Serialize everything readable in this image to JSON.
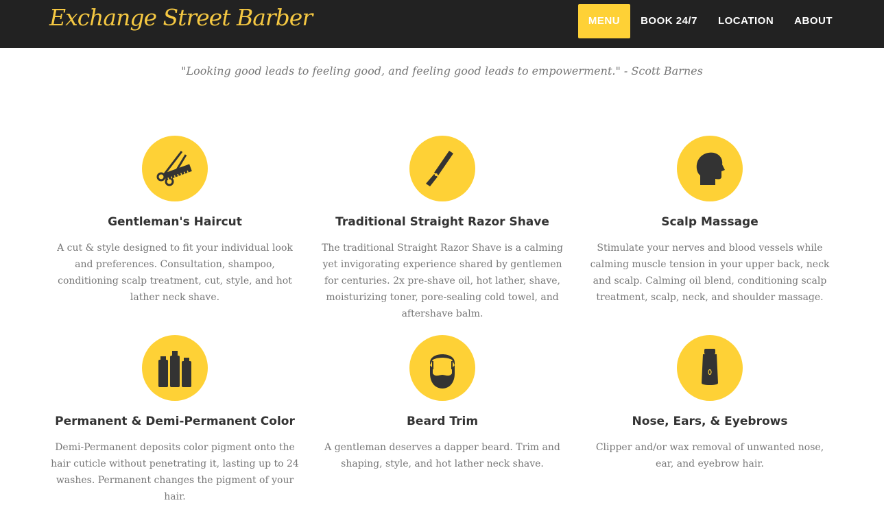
{
  "brand": {
    "name": "Exchange Street Barber",
    "accent": "#fed136",
    "nav_bg": "#222222"
  },
  "nav": {
    "items": [
      {
        "label": "MENU",
        "active": true
      },
      {
        "label": "BOOK 24/7",
        "active": false
      },
      {
        "label": "LOCATION",
        "active": false
      },
      {
        "label": "ABOUT",
        "active": false
      }
    ]
  },
  "quote": "\"Looking good leads to feeling good, and feeling good leads to empowerment.\" - Scott Barnes",
  "services": [
    {
      "icon": "scissors-comb-icon",
      "title": "Gentleman's Haircut",
      "description": "A cut & style designed to fit your individual look and preferences. Consultation, shampoo, conditioning scalp treatment, cut, style, and hot lather neck shave."
    },
    {
      "icon": "straight-razor-icon",
      "title": "Traditional Straight Razor Shave",
      "description": "The traditional Straight Razor Shave is a calming yet invigorating experience shared by gentlemen for centuries. 2x pre-shave oil, hot lather, shave, moisturizing toner, pore-sealing cold towel, and aftershave balm."
    },
    {
      "icon": "head-silhouette-icon",
      "title": "Scalp Massage",
      "description": "Stimulate your nerves and blood vessels while calming muscle tension in your upper back, neck and scalp. Calming oil blend, conditioning scalp treatment, scalp, neck, and shoulder massage."
    },
    {
      "icon": "color-bottles-icon",
      "title": "Permanent & Demi-Permanent Color",
      "description": "Demi-Permanent deposits color pigment onto the hair cuticle without penetrating it, lasting up to 24 washes. Permanent changes the pigment of your hair."
    },
    {
      "icon": "bearded-face-icon",
      "title": "Beard Trim",
      "description": "A gentleman deserves a dapper beard. Trim and shaping, style, and hot lather neck shave."
    },
    {
      "icon": "trimmer-icon",
      "title": "Nose, Ears, & Eyebrows",
      "description": "Clipper and/or wax removal of unwanted nose, ear, and eyebrow hair."
    }
  ]
}
